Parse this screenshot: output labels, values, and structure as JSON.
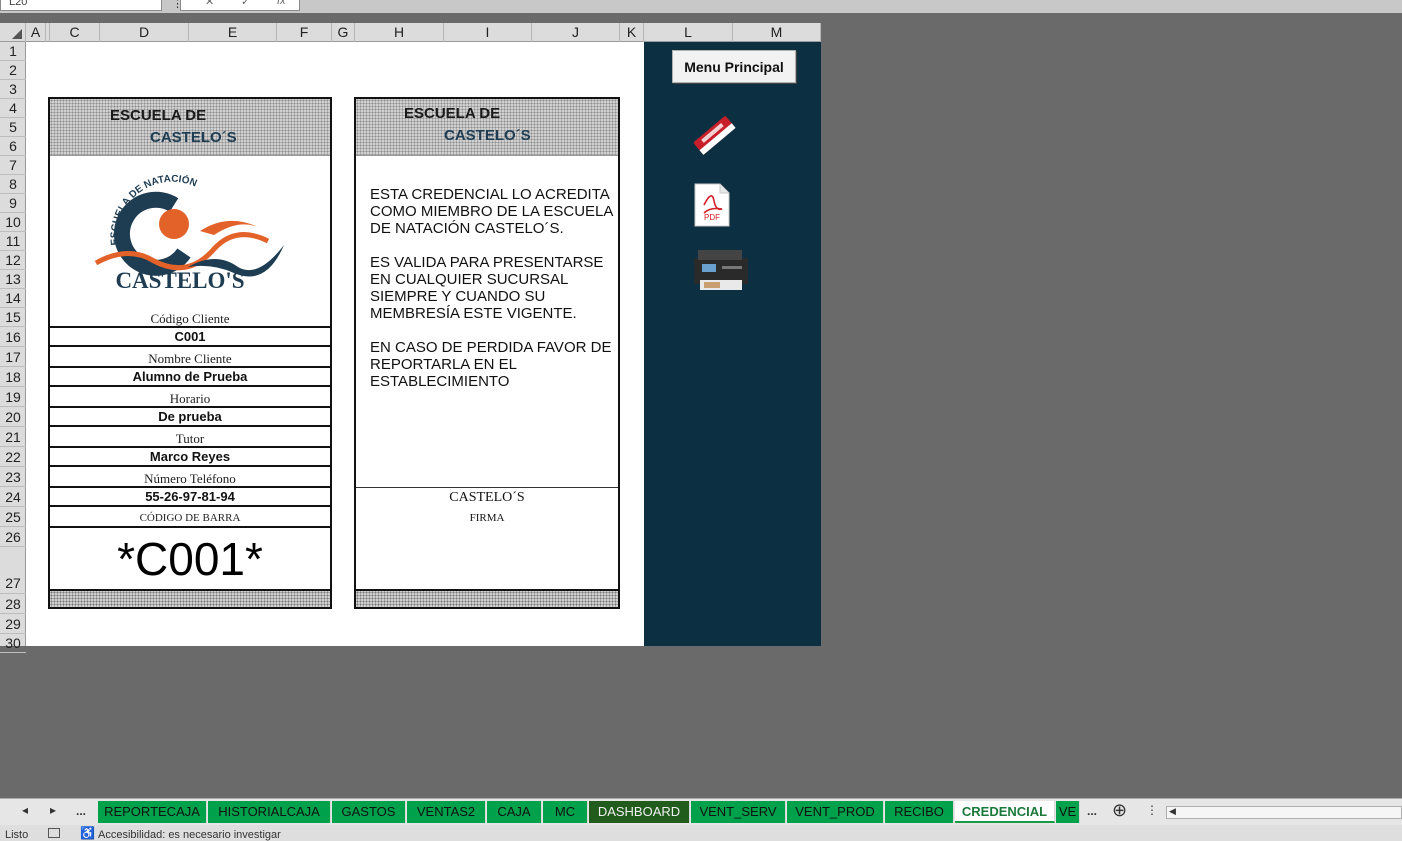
{
  "formula_bar": {
    "name_box": "L20",
    "more_icon": "⋮",
    "cancel_icon": "✕",
    "enter_icon": "✓",
    "fx_label": "fx"
  },
  "columns": [
    "A",
    "C",
    "D",
    "E",
    "F",
    "G",
    "H",
    "I",
    "J",
    "K",
    "L",
    "M"
  ],
  "rows": [
    "1",
    "2",
    "3",
    "4",
    "5",
    "6",
    "7",
    "8",
    "9",
    "10",
    "11",
    "12",
    "13",
    "14",
    "15",
    "16",
    "17",
    "18",
    "19",
    "20",
    "21",
    "22",
    "23",
    "24",
    "25",
    "26",
    "27",
    "28",
    "29",
    "30"
  ],
  "front_card": {
    "header_line1": "ESCUELA DE",
    "header_line2": "CASTELO´S",
    "logo_arc_text": "ESCUELA DE NATACIÓN",
    "logo_name": "CASTELO'S",
    "fields": [
      {
        "label": "Código Cliente",
        "value": "C001"
      },
      {
        "label": "Nombre Cliente",
        "value": "Alumno de Prueba"
      },
      {
        "label": "Horario",
        "value": "De prueba"
      },
      {
        "label": "Tutor",
        "value": "Marco Reyes"
      },
      {
        "label": "Número Teléfono",
        "value": "55-26-97-81-94"
      }
    ],
    "barcode_label": "CÓDIGO DE BARRA",
    "barcode_value": "*C001*"
  },
  "back_card": {
    "header_line1": "ESCUELA DE",
    "header_line2": "CASTELO´S",
    "paragraphs": [
      "ESTA CREDENCIAL LO ACREDITA COMO MIEMBRO DE LA ESCUELA DE NATACIÓN CASTELO´S.",
      "ES VALIDA PARA PRESENTARSE EN CUALQUIER SUCURSAL SIEMPRE Y CUANDO SU MEMBRESÍA ESTE VIGENTE.",
      "EN CASO DE PERDIDA FAVOR DE REPORTARLA EN EL ESTABLECIMIENTO"
    ],
    "signature_name": "CASTELO´S",
    "signature_label": "FIRMA"
  },
  "side_panel": {
    "menu_button": "Menu Principal",
    "pdf_icon_text": "PDF",
    "icons": [
      "eraser-icon",
      "pdf-icon",
      "printer-icon"
    ]
  },
  "sheet_tabs": {
    "nav_prev": "◂",
    "nav_next": "▸",
    "ellipsis_left": "...",
    "tabs": [
      "REPORTECAJA",
      "HISTORIALCAJA",
      "GASTOS",
      "VENTAS2",
      "CAJA",
      "MC",
      "DASHBOARD",
      "VENT_SERV",
      "VENT_PROD",
      "RECIBO",
      "CREDENCIAL",
      "VE"
    ],
    "active_tab": "CREDENCIAL",
    "ellipsis_right": "...",
    "add_sheet_icon": "⊕",
    "options_icon": "⋮"
  },
  "status_bar": {
    "ready": "Listo",
    "accessibility": "Accesibilidad: es necesario investigar"
  },
  "colors": {
    "panel_bg": "#0d2f42",
    "tab_green": "#00a14b",
    "tab_dark": "#215c1c",
    "logo_blue": "#1e3c52",
    "logo_orange": "#e3622a"
  }
}
